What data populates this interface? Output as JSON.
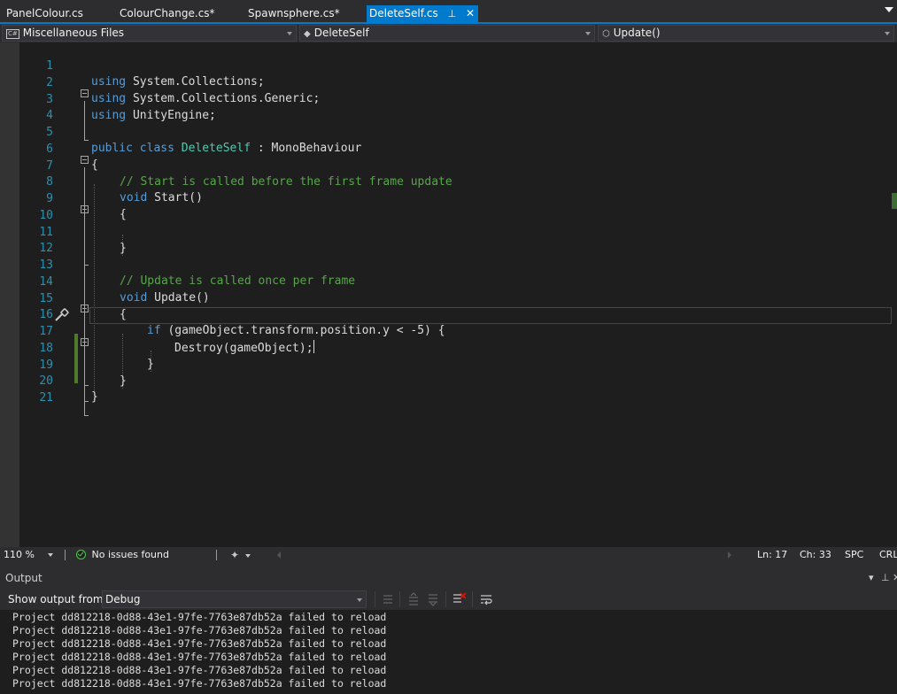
{
  "tabs": [
    {
      "label": "PanelColour.cs",
      "active": false
    },
    {
      "label": "ColourChange.cs*",
      "active": false
    },
    {
      "label": "Spawnsphere.cs*",
      "active": false
    },
    {
      "label": "DeleteSelf.cs",
      "active": true
    }
  ],
  "navbar": {
    "project": "Miscellaneous Files",
    "type": "DeleteSelf",
    "member": "Update()"
  },
  "code": {
    "line_numbers": [
      "1",
      "2",
      "3",
      "4",
      "5",
      "6",
      "7",
      "8",
      "9",
      "10",
      "11",
      "12",
      "13",
      "14",
      "15",
      "16",
      "17",
      "18",
      "19",
      "20",
      "21"
    ],
    "l1_kw": "using",
    "l1_rest": " System.Collections;",
    "l2_kw": "using",
    "l2_rest": " System.Collections.Generic;",
    "l3_kw": "using",
    "l3_rest": " UnityEngine;",
    "l5_kw1": "public",
    "l5_kw2": "class",
    "l5_type": "DeleteSelf",
    "l5_colon": " : ",
    "l5_base": "MonoBehaviour",
    "l6": "{",
    "l7_comment": "// Start is called before the first frame update",
    "l8_kw": "void",
    "l8_rest": " Start()",
    "l9": "{",
    "l11": "}",
    "l13_comment": "// Update is called once per frame",
    "l14_kw": "void",
    "l14_rest": " Update()",
    "l15": "{",
    "l16_kw": "if",
    "l16_rest": " (gameObject.transform.position.y < -5) {",
    "l17": "Destroy(gameObject);",
    "l18": "}",
    "l19": "}",
    "l20": "}"
  },
  "status": {
    "zoom": "110 %",
    "issues": "No issues found",
    "line": "Ln: 17",
    "col": "Ch: 33",
    "whitespace": "SPC",
    "line_ending": "CRL"
  },
  "output": {
    "title": "Output",
    "show_from_label": "Show output from:",
    "source": "Debug",
    "lines": [
      "Project dd812218-0d88-43e1-97fe-7763e87db52a failed to reload",
      "Project dd812218-0d88-43e1-97fe-7763e87db52a failed to reload",
      "Project dd812218-0d88-43e1-97fe-7763e87db52a failed to reload",
      "Project dd812218-0d88-43e1-97fe-7763e87db52a failed to reload",
      "Project dd812218-0d88-43e1-97fe-7763e87db52a failed to reload",
      "Project dd812218-0d88-43e1-97fe-7763e87db52a failed to reload"
    ]
  },
  "icons": {
    "tab_pin": "pin-icon",
    "tab_close": "close-icon",
    "nav_type": "class-icon",
    "nav_member": "method-icon",
    "issues": "check-circle-icon",
    "refactor": "brush-icon",
    "quick_actions": "screwdriver-icon"
  },
  "colors": {
    "accent": "#007acc",
    "editor_bg": "#1e1e1e",
    "keyword": "#569cd6",
    "type": "#4ec9b0",
    "comment": "#57a64a",
    "line_number": "#2b91af",
    "change_bar": "#4f7a2a"
  }
}
